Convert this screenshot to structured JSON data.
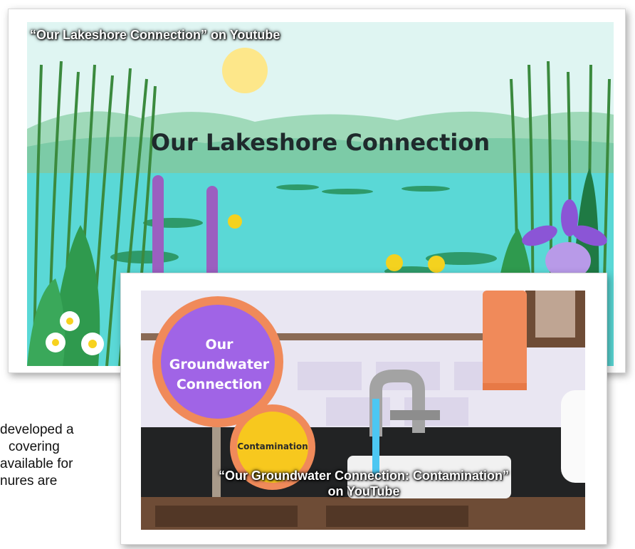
{
  "body_text": {
    "lines": [
      "developed a",
      "covering",
      "available for",
      "nures are"
    ]
  },
  "video1": {
    "caption": "“Our Lakeshore Connection” on Youtube",
    "title": "Our Lakeshore Connection"
  },
  "video2": {
    "caption_line1": "“Our Groundwater Connection: Contamination”",
    "caption_line2": "on YouTube",
    "circle_line1": "Our",
    "circle_line2": "Groundwater",
    "circle_line3": "Connection",
    "badge": "Contamination"
  },
  "colors": {
    "sky": "#d9f4f1",
    "water": "#58d6d6",
    "sun": "#fde78a",
    "purple": "#a064e6",
    "orange": "#f08a5a",
    "yellow": "#f7c81e"
  }
}
